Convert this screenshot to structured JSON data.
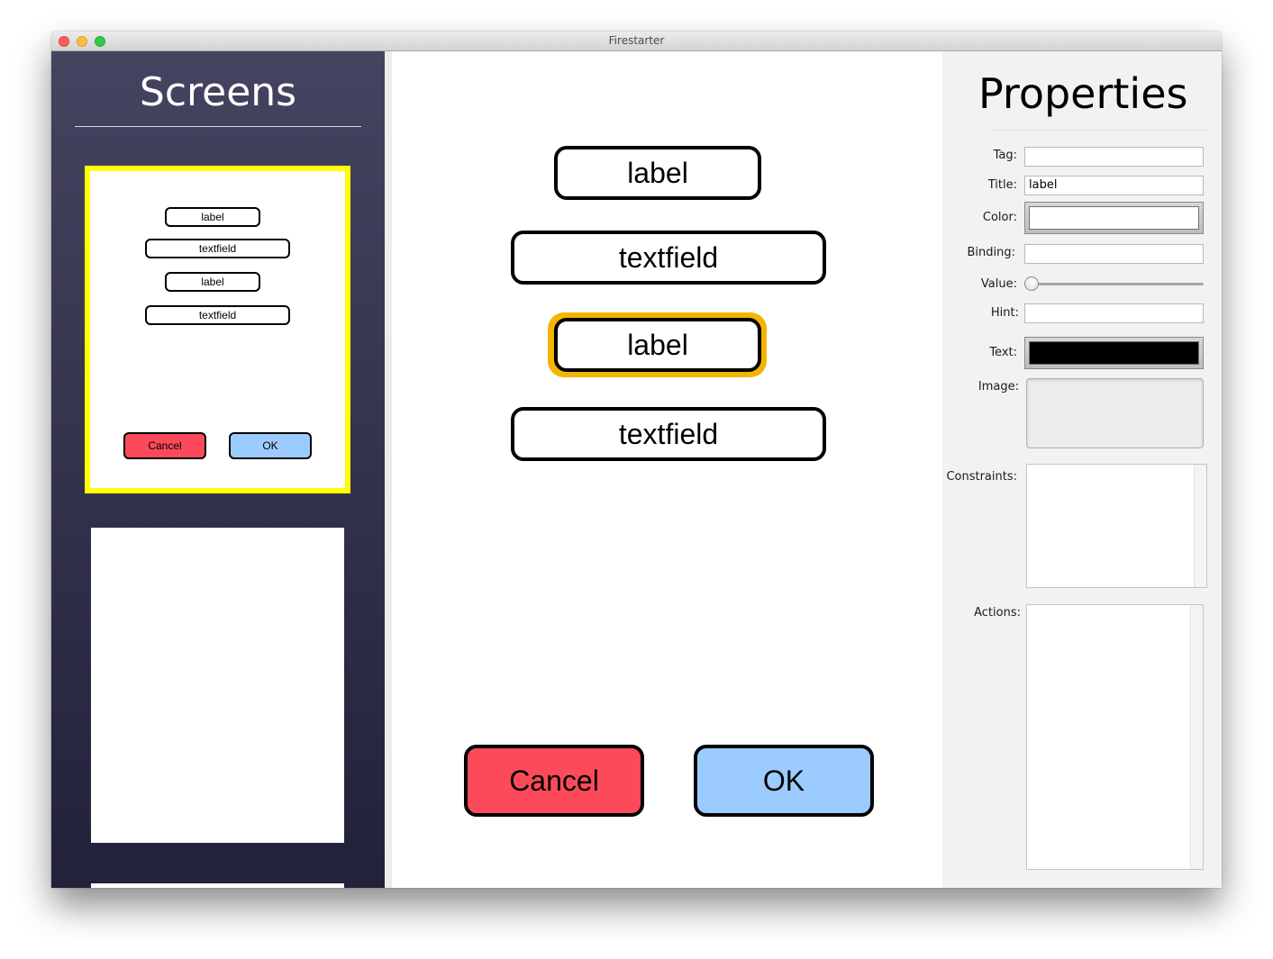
{
  "window": {
    "title": "Firestarter"
  },
  "sidebar": {
    "heading": "Screens",
    "thumbnail_1": {
      "items": [
        "label",
        "textfield",
        "label",
        "textfield"
      ],
      "cancel_label": "Cancel",
      "ok_label": "OK",
      "selected_border_color": "#ffff00"
    }
  },
  "canvas": {
    "widgets": [
      "label",
      "textfield",
      "label",
      "textfield"
    ],
    "selected_widget_color": "#f5b400",
    "cancel_label": "Cancel",
    "ok_label": "OK",
    "cancel_color": "#fc4a5a",
    "ok_color": "#9ccbff"
  },
  "properties": {
    "heading": "Properties",
    "tag": {
      "label": "Tag:",
      "value": ""
    },
    "title": {
      "label": "Title:",
      "value": "label"
    },
    "color": {
      "label": "Color:",
      "value": "#ffffff"
    },
    "binding": {
      "label": "Binding:",
      "value": ""
    },
    "value": {
      "label": "Value:",
      "level": 0
    },
    "hint": {
      "label": "Hint:",
      "value": ""
    },
    "text": {
      "label": "Text:",
      "value": "#000000"
    },
    "image": {
      "label": "Image:"
    },
    "constraints": {
      "label": "Constraints:"
    },
    "actions": {
      "label": "Actions:"
    }
  }
}
